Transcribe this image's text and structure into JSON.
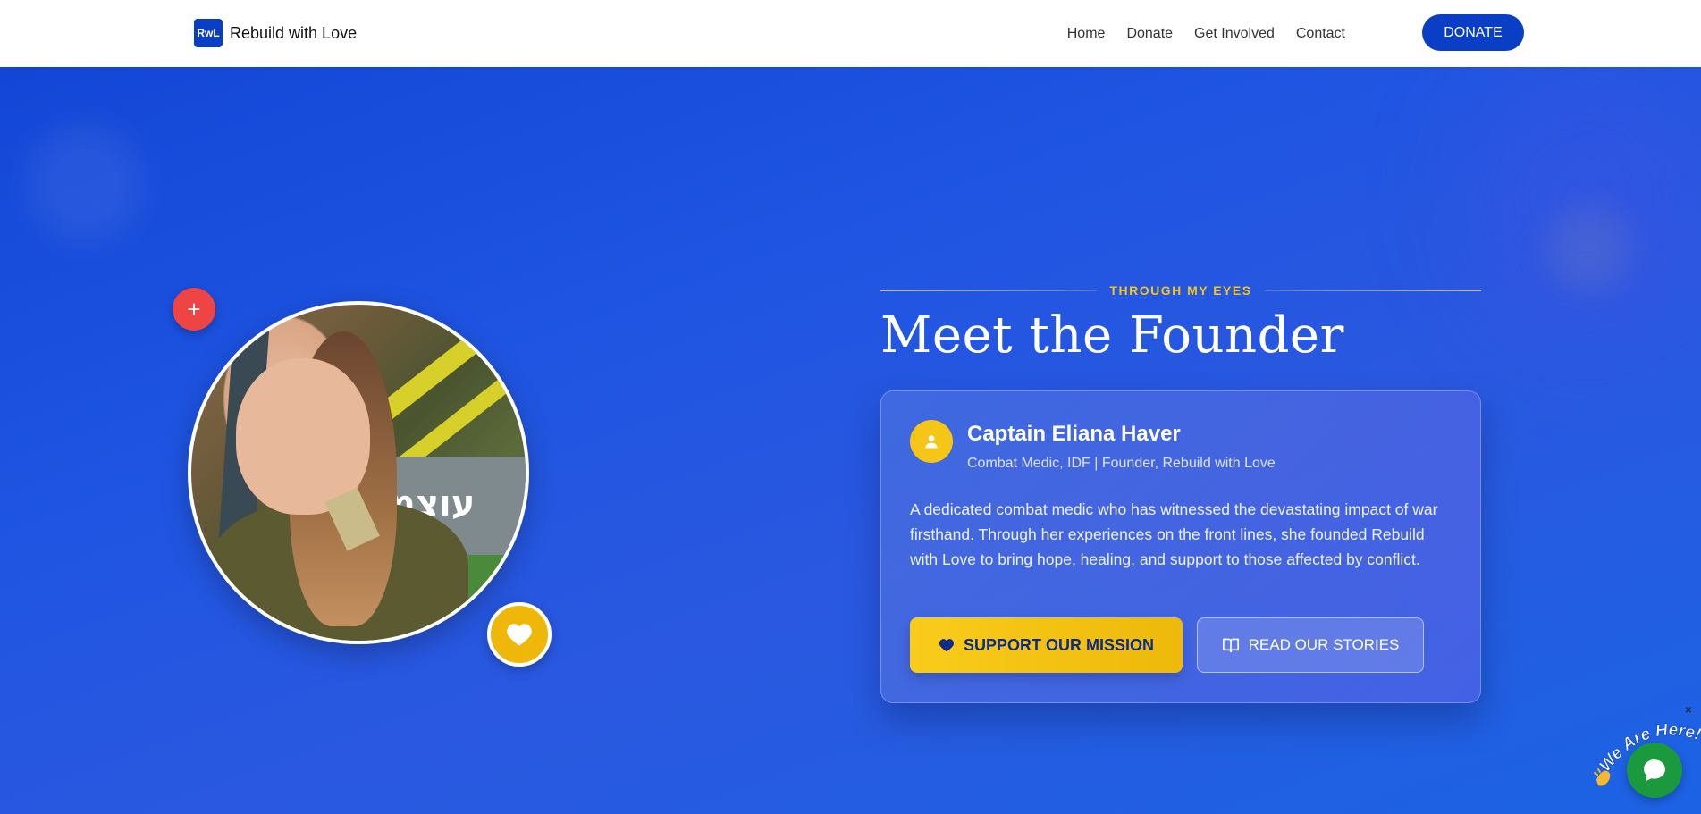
{
  "nav": {
    "logo_text": "RwL",
    "brand_name": "Rebuild with Love",
    "links": [
      "Home",
      "Donate",
      "Get Involved",
      "Contact"
    ],
    "donate_label": "DONATE"
  },
  "hero": {
    "eyebrow": "THROUGH MY EYES",
    "title": "Meet the Founder",
    "plus_badge": "+",
    "photo_overlay_text": "עוצמ"
  },
  "card": {
    "name": "Captain Eliana Haver",
    "role": "Combat Medic, IDF | Founder, Rebuild with Love",
    "bio": "A dedicated combat medic who has witnessed the devastating impact of war firsthand. Through her experiences on the front lines, she founded Rebuild with Love to bring hope, healing, and support to those affected by conflict.",
    "support_label": "SUPPORT OUR MISSION",
    "read_label": "READ OUR STORIES"
  },
  "chat": {
    "tagline": "We Are Here!",
    "close_label": "×"
  },
  "colors": {
    "brand_blue": "#0a3ec4",
    "accent_yellow": "#f5c518",
    "badge_red": "#ef4444",
    "chat_green": "#1a9a3d"
  },
  "icons": [
    "plus-icon",
    "heart-icon",
    "user-icon",
    "book-icon",
    "chat-icon",
    "wave-hand-icon"
  ]
}
